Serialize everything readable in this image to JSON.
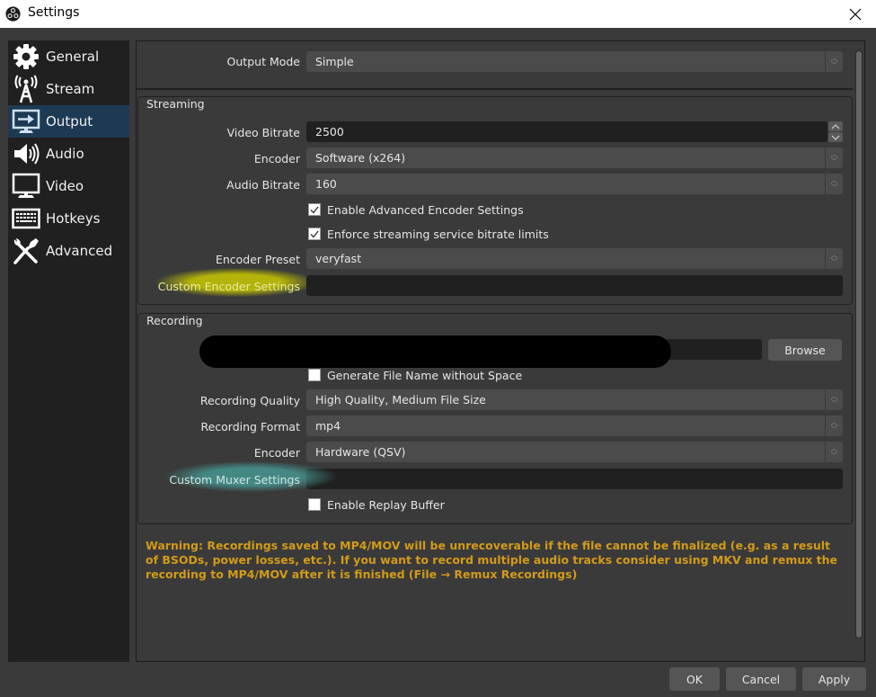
{
  "window": {
    "title": "Settings",
    "app_icon": "obs-logo-icon",
    "close_icon": "close-icon"
  },
  "sidebar": {
    "active_index": 2,
    "items": [
      {
        "label": "General",
        "icon": "gear-icon"
      },
      {
        "label": "Stream",
        "icon": "broadcast-antenna-icon"
      },
      {
        "label": "Output",
        "icon": "monitor-output-icon"
      },
      {
        "label": "Audio",
        "icon": "speaker-icon"
      },
      {
        "label": "Video",
        "icon": "monitor-icon"
      },
      {
        "label": "Hotkeys",
        "icon": "keyboard-icon"
      },
      {
        "label": "Advanced",
        "icon": "tools-icon"
      }
    ]
  },
  "output_mode": {
    "label": "Output Mode",
    "value": "Simple"
  },
  "streaming": {
    "title": "Streaming",
    "video_bitrate": {
      "label": "Video Bitrate",
      "value": "2500"
    },
    "encoder": {
      "label": "Encoder",
      "value": "Software (x264)"
    },
    "audio_bitrate": {
      "label": "Audio Bitrate",
      "value": "160"
    },
    "enable_advanced": {
      "label": "Enable Advanced Encoder Settings",
      "checked": true
    },
    "enforce_limits": {
      "label": "Enforce streaming service bitrate limits",
      "checked": true
    },
    "encoder_preset": {
      "label": "Encoder Preset",
      "value": "veryfast"
    },
    "custom_encoder": {
      "label": "Custom Encoder Settings",
      "value": ""
    }
  },
  "recording": {
    "title": "Recording",
    "path": {
      "value": "",
      "redacted": true
    },
    "browse_label": "Browse",
    "no_space": {
      "label": "Generate File Name without Space",
      "checked": false
    },
    "quality": {
      "label": "Recording Quality",
      "value": "High Quality, Medium File Size"
    },
    "format": {
      "label": "Recording Format",
      "value": "mp4"
    },
    "encoder": {
      "label": "Encoder",
      "value": "Hardware (QSV)"
    },
    "custom_muxer": {
      "label": "Custom Muxer Settings",
      "value": ""
    },
    "replay_buffer": {
      "label": "Enable Replay Buffer",
      "checked": false
    }
  },
  "warning": {
    "text": "Warning: Recordings saved to MP4/MOV will be unrecoverable if the file cannot be finalized (e.g. as a result of BSODs, power losses, etc.). If you want to record multiple audio tracks consider using MKV and remux the recording to MP4/MOV after it is finished (File → Remux Recordings)",
    "color": "#d39b1a"
  },
  "footer": {
    "ok_label": "OK",
    "cancel_label": "Cancel",
    "apply_label": "Apply"
  },
  "colors": {
    "active_sidebar": "#1d3a55",
    "highlight_yellow": "#c8c800",
    "highlight_teal": "#469691"
  }
}
